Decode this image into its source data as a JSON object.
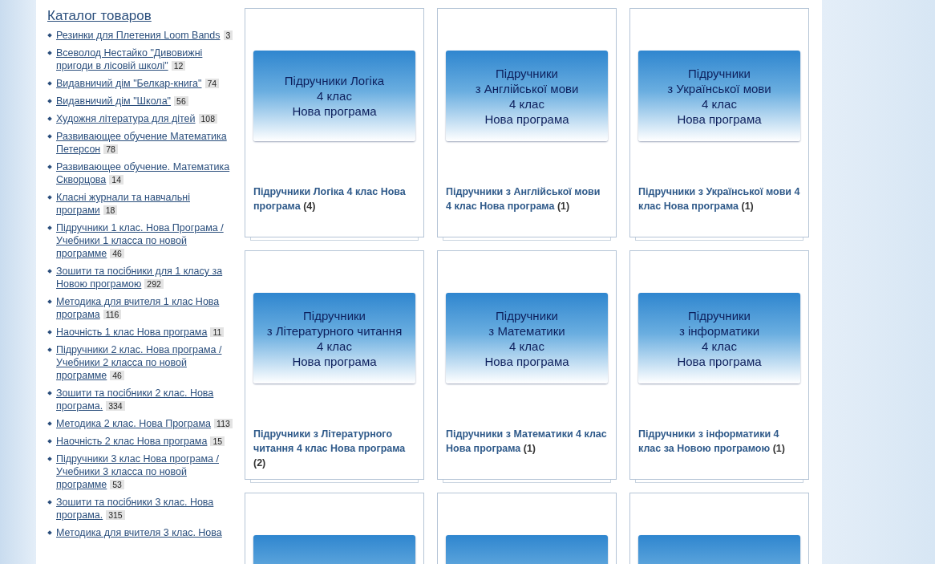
{
  "sidebar": {
    "title": "Каталог товаров",
    "items": [
      {
        "label": "Резинки для Плетения Loom Bands",
        "count": "3"
      },
      {
        "label": "Всеволод Нестайко \"Дивовижні пригоди в лісовій школі\"",
        "count": "12"
      },
      {
        "label": "Видавничий дім \"Белкар-книга\"",
        "count": "74"
      },
      {
        "label": "Видавничий дім \"Школа\"",
        "count": "56"
      },
      {
        "label": "Художня література для дітей",
        "count": "108"
      },
      {
        "label": "Развивающее обучение Математика Петерсон",
        "count": "78"
      },
      {
        "label": "Развивающее обучение. Математика Скворцова",
        "count": "14"
      },
      {
        "label": "Класні журнали та навчальні програми",
        "count": "18"
      },
      {
        "label": "Підручники 1 клас. Нова Програма / Учебники 1 класса по новой программе",
        "count": "46"
      },
      {
        "label": "Зошити та посібники для 1 класу за Новою програмою",
        "count": "292"
      },
      {
        "label": "Методика для вчителя 1 клас Нова програма",
        "count": "116"
      },
      {
        "label": "Наочність 1 клас Нова програма",
        "count": "11"
      },
      {
        "label": "Підручники 2 клас. Нова програма / Учебники 2 класса по новой программе",
        "count": "46"
      },
      {
        "label": "Зошити та посібники 2 клас. Нова програма.",
        "count": "334"
      },
      {
        "label": "Методика 2 клас. Нова Програма",
        "count": "113"
      },
      {
        "label": "Наочність 2 клас Нова програма",
        "count": "15"
      },
      {
        "label": "Підручники 3 клас Нова програма / Учебники 3 класса по новой программе",
        "count": "53"
      },
      {
        "label": "Зошити та посібники 3 клас. Нова програма.",
        "count": "315"
      },
      {
        "label": "Методика для вчителя 3 клас. Нова"
      }
    ]
  },
  "categories": [
    {
      "kind": "category",
      "banner_lines": [
        "Підручники Логіка",
        "4 клас",
        "Нова програма"
      ],
      "title": "Підручники Логіка 4 клас Нова програма",
      "count": "(4)"
    },
    {
      "kind": "category",
      "banner_lines": [
        "Підручники",
        "з Англійської мови",
        "4 клас",
        "Нова програма"
      ],
      "title": "Підручники з Англійської мови 4 клас Нова програма",
      "count": "(1)"
    },
    {
      "kind": "category",
      "banner_lines": [
        "Підручники",
        "з Української мови",
        "4 клас",
        "Нова програма"
      ],
      "title": "Підручники з Української мови 4 клас Нова програма",
      "count": "(1)"
    },
    {
      "kind": "category",
      "banner_lines": [
        "Підручники",
        "з Літературного читання",
        "4 клас",
        "Нова програма"
      ],
      "title": "Підручники з Літературного читання 4 клас Нова програма",
      "count": "(2)"
    },
    {
      "kind": "category",
      "banner_lines": [
        "Підручники",
        "з Математики",
        "4 клас",
        "Нова програма"
      ],
      "title": "Підручники з Математики 4 клас Нова програма",
      "count": "(1)"
    },
    {
      "kind": "category",
      "banner_lines": [
        "Підручники",
        "з інформатики",
        "4 клас",
        "Нова програма"
      ],
      "title": "Підручники з інформатики 4 клас за Новою програмою",
      "count": "(1)"
    },
    {
      "kind": "partial"
    },
    {
      "kind": "partial"
    },
    {
      "kind": "partial"
    }
  ]
}
